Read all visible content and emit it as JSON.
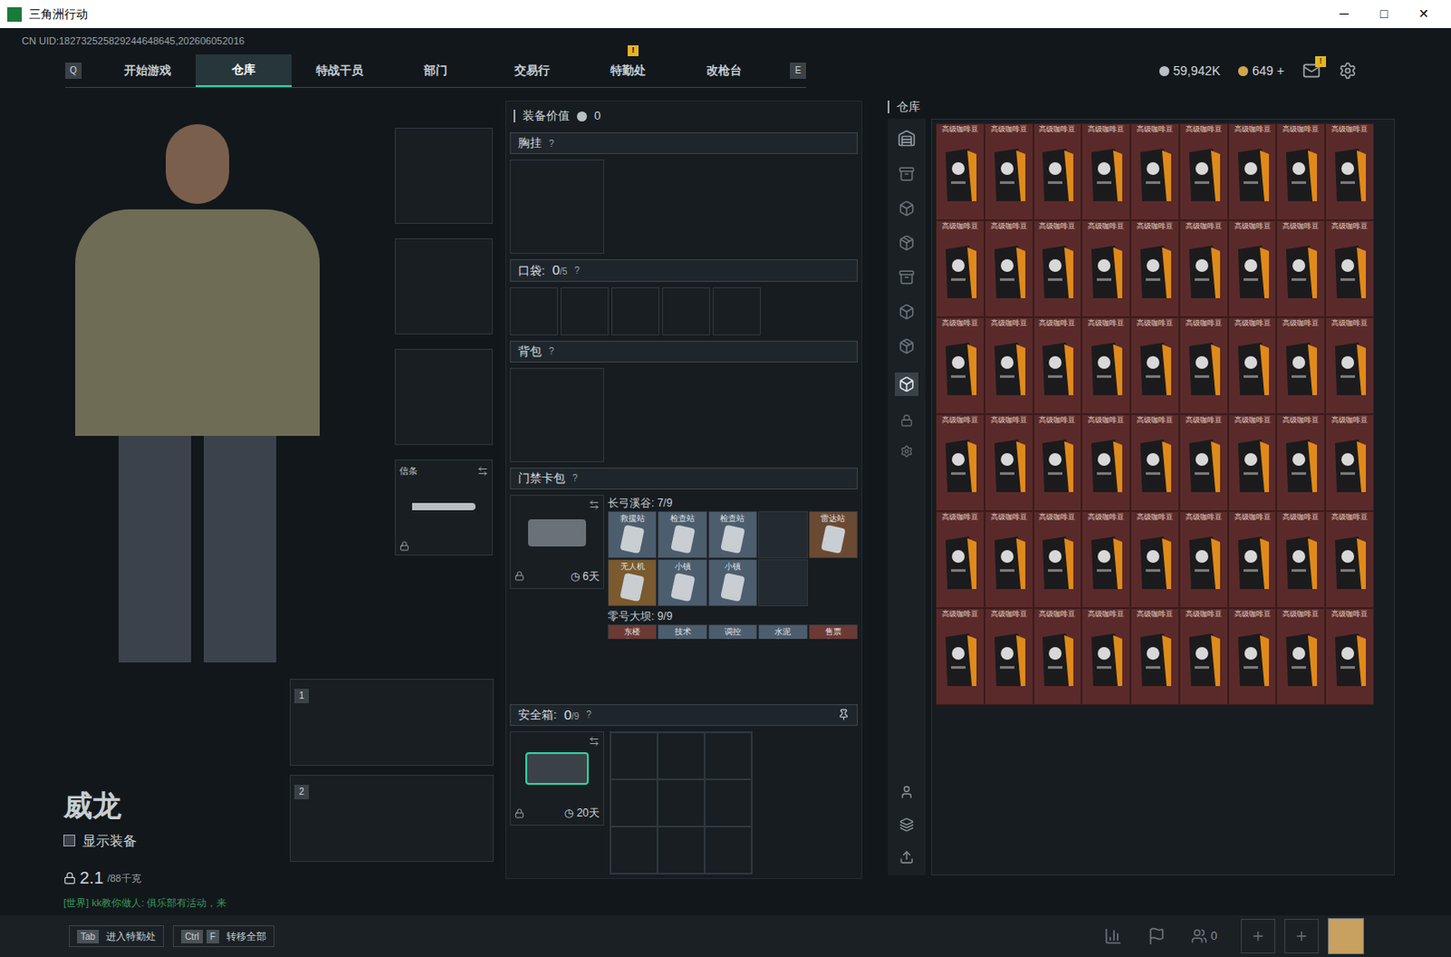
{
  "window": {
    "title": "三角洲行动",
    "controls": [
      "─",
      "□",
      "✕"
    ]
  },
  "uid": "CN UID:182732525829244648645,202606052016",
  "nav": {
    "prev_key": "Q",
    "next_key": "E",
    "tabs": [
      {
        "label": "开始游戏",
        "selected": false,
        "badge": ""
      },
      {
        "label": "仓库",
        "selected": true,
        "badge": ""
      },
      {
        "label": "特战干员",
        "selected": false,
        "badge": ""
      },
      {
        "label": "部门",
        "selected": false,
        "badge": ""
      },
      {
        "label": "交易行",
        "selected": false,
        "badge": ""
      },
      {
        "label": "特勤处",
        "selected": false,
        "badge": "!"
      },
      {
        "label": "改枪台",
        "selected": false,
        "badge": ""
      }
    ]
  },
  "wallet": [
    {
      "kind": "coin",
      "value": "59,942K",
      "plus": ""
    },
    {
      "kind": "gold",
      "value": "649",
      "plus": "+"
    }
  ],
  "mail": {
    "badge": "!"
  },
  "character": {
    "name": "威龙",
    "show_equipment": {
      "label": "显示装备",
      "checked": false
    },
    "weight": "2.1",
    "weight_max": "/88千克",
    "chat": "[世界] kk教你做人: 俱乐部有活动，来"
  },
  "equipment": {
    "melee_label": "信条",
    "melee_locked": true,
    "primary_slots": [
      "1",
      "2"
    ]
  },
  "loadout": {
    "value_label": "装备价值",
    "value": "0",
    "chest": {
      "title": "胸挂",
      "help": "?"
    },
    "pockets": {
      "title": "口袋:",
      "count": "0",
      "capacity": "/5",
      "help": "?",
      "slots": 5
    },
    "backpack": {
      "title": "背包",
      "help": "?"
    },
    "keycard": {
      "title": "门禁卡包",
      "help": "?",
      "timer": "6天",
      "locked": true,
      "maps": [
        {
          "name": "长弓溪谷: 7/9",
          "cards": [
            {
              "label": "救援站",
              "filled": true,
              "color": "#4c5d6e"
            },
            {
              "label": "检查站",
              "filled": true,
              "color": "#4c5d6e"
            },
            {
              "label": "检查站",
              "filled": true,
              "color": "#4c5d6e"
            },
            {
              "label": "",
              "filled": false,
              "color": "#232a30"
            },
            {
              "label": "雷达站",
              "filled": true,
              "color": "#6b4a34"
            },
            {
              "label": "无人机",
              "filled": true,
              "color": "#7a5a2e"
            },
            {
              "label": "小镇",
              "filled": true,
              "color": "#4c5d6e"
            },
            {
              "label": "小镇",
              "filled": true,
              "color": "#4c5d6e"
            },
            {
              "label": "",
              "filled": false,
              "color": "#232a30"
            }
          ]
        },
        {
          "name": "零号大坝: 9/9",
          "cards": [
            {
              "label": "东楼",
              "filled": true,
              "color": "#6b3a34"
            },
            {
              "label": "技术",
              "filled": true,
              "color": "#4c5d6e"
            },
            {
              "label": "调控",
              "filled": true,
              "color": "#4c5d6e"
            },
            {
              "label": "水泥",
              "filled": true,
              "color": "#4c5d6e"
            },
            {
              "label": "售票",
              "filled": true,
              "color": "#6b3a34"
            }
          ]
        }
      ]
    },
    "safe": {
      "title": "安全箱:",
      "count": "0",
      "capacity": "/9",
      "help": "?",
      "timer": "20天",
      "locked": true,
      "slots": 9
    }
  },
  "stash": {
    "title": "仓库",
    "items": [
      {
        "label": "高级咖啡豆"
      },
      {
        "label": "高级咖啡豆"
      },
      {
        "label": "高级咖啡豆"
      },
      {
        "label": "高级咖啡豆"
      },
      {
        "label": "高级咖啡豆"
      },
      {
        "label": "高级咖啡豆"
      },
      {
        "label": "高级咖啡豆"
      },
      {
        "label": "高级咖啡豆"
      },
      {
        "label": "高级咖啡豆"
      },
      {
        "label": "高级咖啡豆"
      },
      {
        "label": "高级咖啡豆"
      },
      {
        "label": "高级咖啡豆"
      },
      {
        "label": "高级咖啡豆"
      },
      {
        "label": "高级咖啡豆"
      },
      {
        "label": "高级咖啡豆"
      },
      {
        "label": "高级咖啡豆"
      },
      {
        "label": "高级咖啡豆"
      },
      {
        "label": "高级咖啡豆"
      },
      {
        "label": "高级咖啡豆"
      },
      {
        "label": "高级咖啡豆"
      },
      {
        "label": "高级咖啡豆"
      },
      {
        "label": "高级咖啡豆"
      },
      {
        "label": "高级咖啡豆"
      },
      {
        "label": "高级咖啡豆"
      },
      {
        "label": "高级咖啡豆"
      },
      {
        "label": "高级咖啡豆"
      },
      {
        "label": "高级咖啡豆"
      },
      {
        "label": "高级咖啡豆"
      },
      {
        "label": "高级咖啡豆"
      },
      {
        "label": "高级咖啡豆"
      },
      {
        "label": "高级咖啡豆"
      },
      {
        "label": "高级咖啡豆"
      },
      {
        "label": "高级咖啡豆"
      },
      {
        "label": "高级咖啡豆"
      },
      {
        "label": "高级咖啡豆"
      },
      {
        "label": "高级咖啡豆"
      },
      {
        "label": "高级咖啡豆"
      },
      {
        "label": "高级咖啡豆"
      },
      {
        "label": "高级咖啡豆"
      },
      {
        "label": "高级咖啡豆"
      },
      {
        "label": "高级咖啡豆"
      },
      {
        "label": "高级咖啡豆"
      },
      {
        "label": "高级咖啡豆"
      },
      {
        "label": "高级咖啡豆"
      },
      {
        "label": "高级咖啡豆"
      },
      {
        "label": "高级咖啡豆"
      },
      {
        "label": "高级咖啡豆"
      },
      {
        "label": "高级咖啡豆"
      },
      {
        "label": "高级咖啡豆"
      },
      {
        "label": "高级咖啡豆"
      },
      {
        "label": "高级咖啡豆"
      },
      {
        "label": "高级咖啡豆"
      },
      {
        "label": "高级咖啡豆"
      },
      {
        "label": "高级咖啡豆"
      }
    ]
  },
  "hotkeys": [
    {
      "keys": [
        "Tab"
      ],
      "label": "进入特勤处"
    },
    {
      "keys": [
        "Ctrl",
        "F"
      ],
      "label": "转移全部"
    }
  ],
  "footer": {
    "friends": "0"
  }
}
